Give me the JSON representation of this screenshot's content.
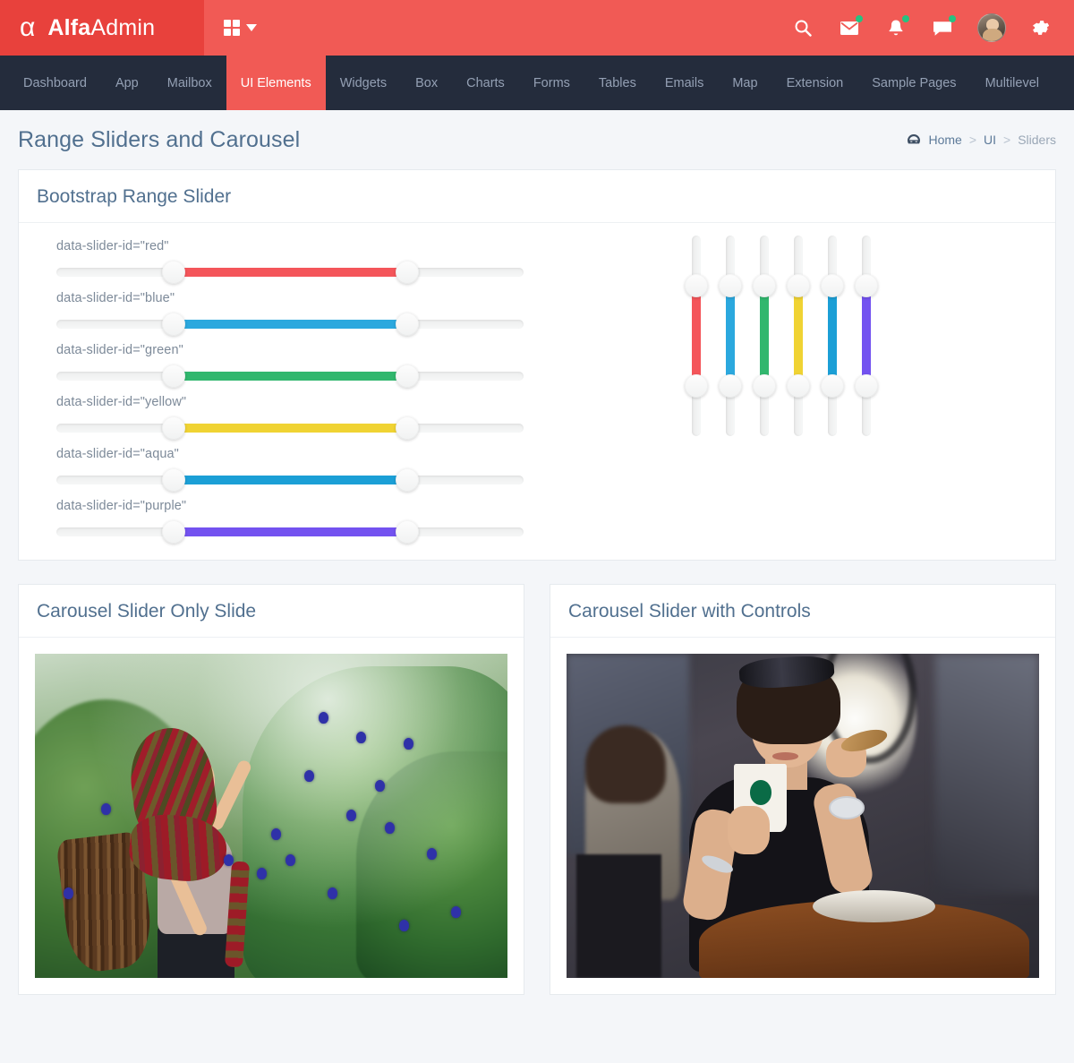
{
  "brand": {
    "logo_glyph": "α",
    "name_bold": "Alfa",
    "name_light": "Admin"
  },
  "topbar": {
    "grid_toggle_label": "grid-toggle",
    "icons": [
      {
        "name": "search-icon",
        "badge": false
      },
      {
        "name": "envelope-icon",
        "badge": true
      },
      {
        "name": "bell-icon",
        "badge": true
      },
      {
        "name": "chat-icon",
        "badge": true
      }
    ],
    "avatar_label": "user-avatar",
    "settings_label": "settings"
  },
  "nav": {
    "items": [
      {
        "label": "Dashboard",
        "active": false
      },
      {
        "label": "App",
        "active": false
      },
      {
        "label": "Mailbox",
        "active": false
      },
      {
        "label": "UI Elements",
        "active": true
      },
      {
        "label": "Widgets",
        "active": false
      },
      {
        "label": "Box",
        "active": false
      },
      {
        "label": "Charts",
        "active": false
      },
      {
        "label": "Forms",
        "active": false
      },
      {
        "label": "Tables",
        "active": false
      },
      {
        "label": "Emails",
        "active": false
      },
      {
        "label": "Map",
        "active": false
      },
      {
        "label": "Extension",
        "active": false
      },
      {
        "label": "Sample Pages",
        "active": false
      },
      {
        "label": "Multilevel",
        "active": false
      }
    ]
  },
  "page": {
    "title": "Range Sliders and Carousel",
    "breadcrumb": {
      "home": "Home",
      "sep1": ">",
      "section": "UI",
      "sep2": ">",
      "current": "Sliders"
    }
  },
  "slider_card": {
    "title": "Bootstrap Range Slider",
    "horizontal_sliders": [
      {
        "label": "data-slider-id=\"red\"",
        "color": "#f4555a",
        "start_pct": 25,
        "end_pct": 75
      },
      {
        "label": "data-slider-id=\"blue\"",
        "color": "#2ba8de",
        "start_pct": 25,
        "end_pct": 75
      },
      {
        "label": "data-slider-id=\"green\"",
        "color": "#31b76e",
        "start_pct": 25,
        "end_pct": 75
      },
      {
        "label": "data-slider-id=\"yellow\"",
        "color": "#f0d333",
        "start_pct": 25,
        "end_pct": 75
      },
      {
        "label": "data-slider-id=\"aqua\"",
        "color": "#1b9fd6",
        "start_pct": 25,
        "end_pct": 75
      },
      {
        "label": "data-slider-id=\"purple\"",
        "color": "#7352f0",
        "start_pct": 25,
        "end_pct": 75
      }
    ],
    "vertical_sliders": [
      {
        "id": "red",
        "color": "#f4555a",
        "start_pct": 25,
        "end_pct": 75
      },
      {
        "id": "blue",
        "color": "#2ba8de",
        "start_pct": 25,
        "end_pct": 75
      },
      {
        "id": "green",
        "color": "#31b76e",
        "start_pct": 25,
        "end_pct": 75
      },
      {
        "id": "yellow",
        "color": "#f0d333",
        "start_pct": 25,
        "end_pct": 75
      },
      {
        "id": "aqua",
        "color": "#1b9fd6",
        "start_pct": 25,
        "end_pct": 75
      },
      {
        "id": "purple",
        "color": "#7352f0",
        "start_pct": 25,
        "end_pct": 75
      }
    ]
  },
  "carousels": [
    {
      "title": "Carousel Slider Only Slide",
      "image_alt": "woman in red striped headscarf harvesting blue butterfly-pea flowers"
    },
    {
      "title": "Carousel Slider with Controls",
      "image_alt": "woman in black dress holding coffee cup and cookie at a cafe table"
    }
  ],
  "colors": {
    "brand": "#f15a55",
    "brand_dark": "#e8413c",
    "nav_bg": "#242c3c",
    "page_bg": "#f4f6f9",
    "badge": "#26c281"
  }
}
